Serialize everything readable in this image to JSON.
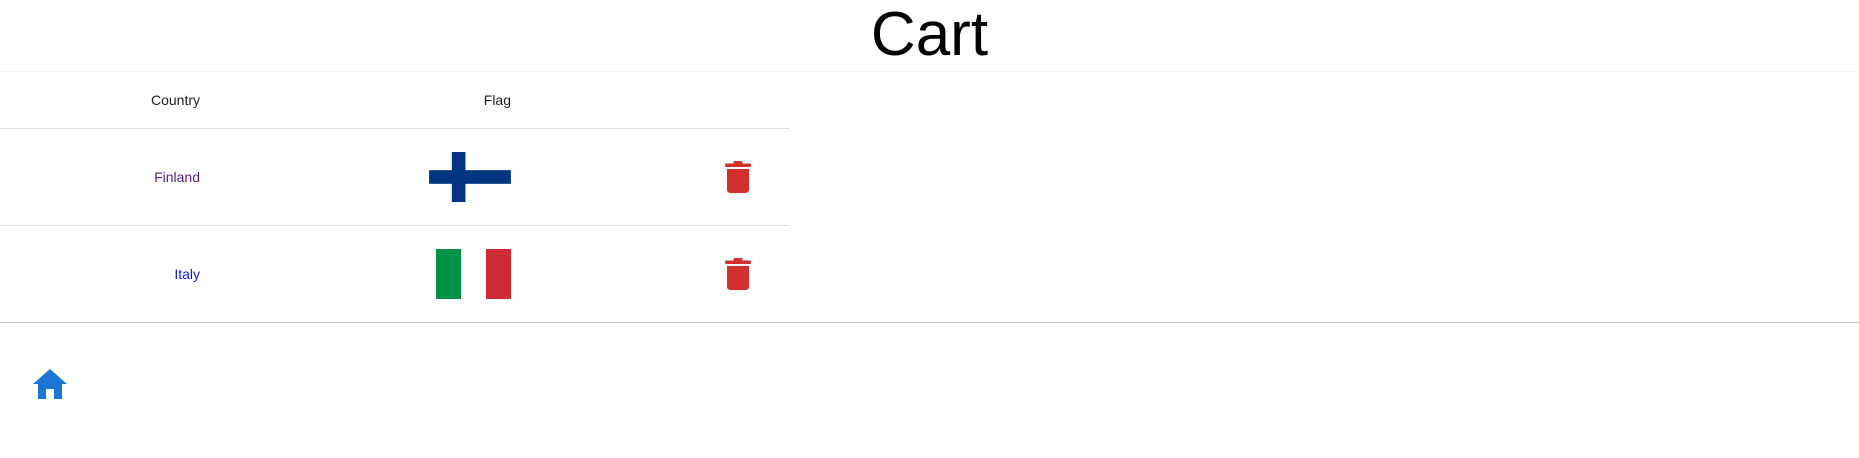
{
  "page": {
    "title": "Cart"
  },
  "table": {
    "headers": {
      "country": "Country",
      "flag": "Flag"
    },
    "rows": [
      {
        "country": "Finland",
        "link_state": "visited",
        "flag_icon": "flag-finland-icon",
        "flag_colors": {
          "background": "#ffffff",
          "cross": "#003580"
        },
        "action_icon": "trash-icon"
      },
      {
        "country": "Italy",
        "link_state": "unvisited",
        "flag_icon": "flag-italy-icon",
        "flag_colors": {
          "left": "#009246",
          "middle": "#ffffff",
          "right": "#ce2b37"
        },
        "action_icon": "trash-icon"
      }
    ]
  },
  "footer": {
    "home_icon": "home-icon"
  },
  "colors": {
    "delete": "#d32f2f",
    "home": "#1976d2",
    "visited_link": "#5a1f8f",
    "link": "#1a1ad6"
  }
}
